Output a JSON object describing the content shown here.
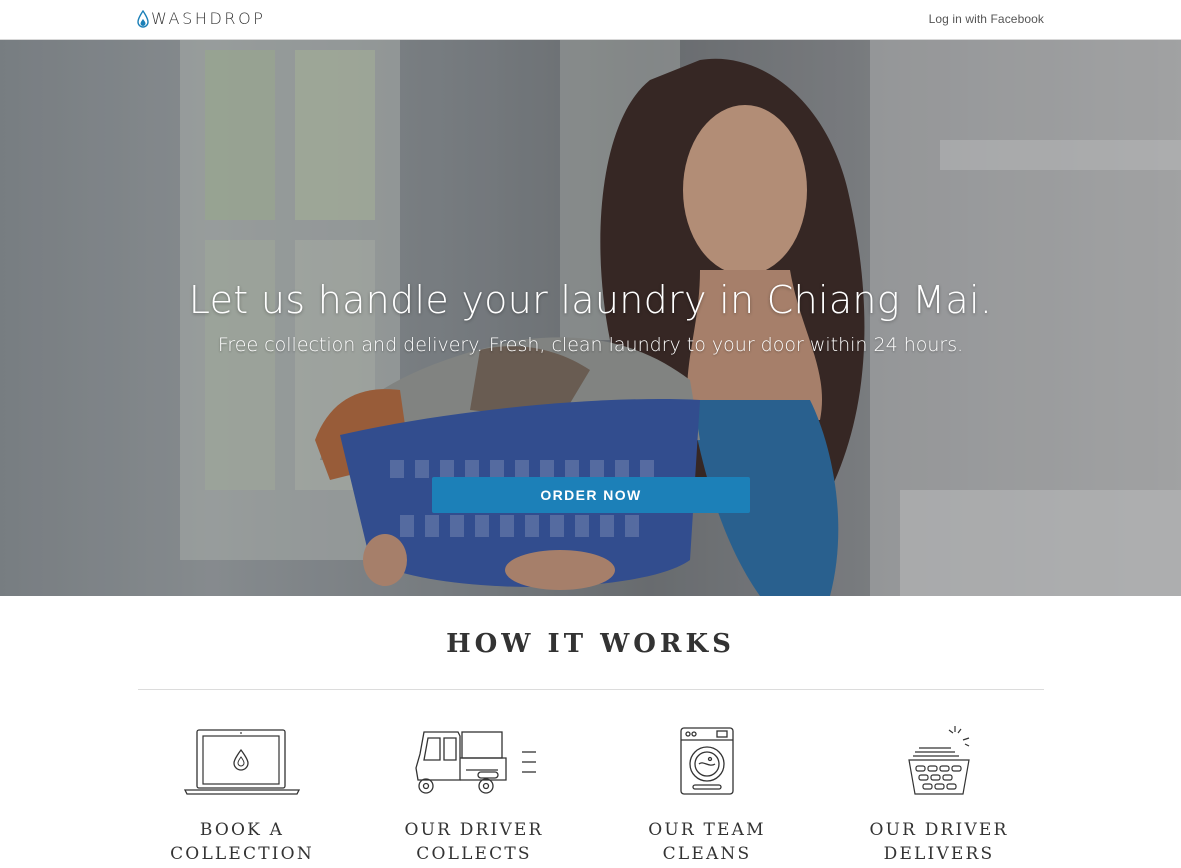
{
  "header": {
    "logo_text": "WASHDROP",
    "logo_icon": "water-drop-icon",
    "login_link": "Log in with Facebook"
  },
  "hero": {
    "title": "Let us handle your laundry in Chiang Mai.",
    "subtitle": "Free collection and delivery. Fresh, clean laundry to your door within 24 hours.",
    "cta_label": "ORDER NOW"
  },
  "how_it_works": {
    "heading": "HOW IT WORKS",
    "steps": [
      {
        "icon": "laptop-icon",
        "line1": "BOOK A",
        "line2": "COLLECTION"
      },
      {
        "icon": "tuk-tuk-icon",
        "line1": "OUR DRIVER",
        "line2": "COLLECTS"
      },
      {
        "icon": "washing-machine-icon",
        "line1": "OUR TEAM",
        "line2": "CLEANS"
      },
      {
        "icon": "laundry-basket-icon",
        "line1": "OUR DRIVER",
        "line2": "DELIVERS"
      }
    ]
  },
  "colors": {
    "accent": "#1c80b8",
    "text": "#333333",
    "hero_text": "#ffffff"
  }
}
